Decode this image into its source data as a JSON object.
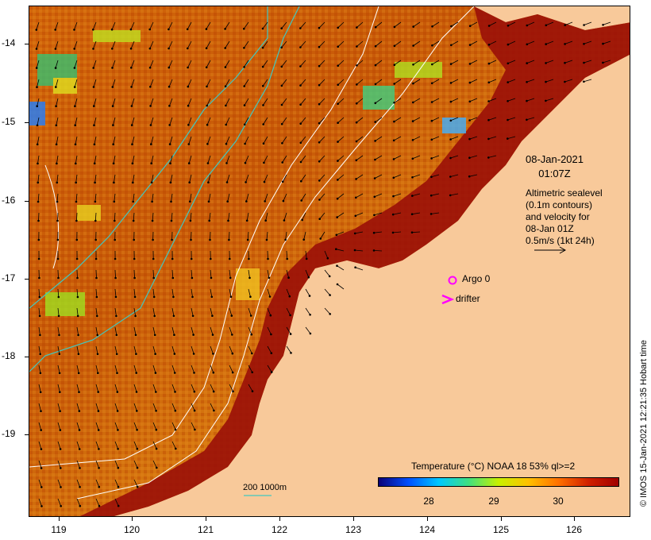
{
  "date_line1": "08-Jan-2021",
  "date_line2": "01:07Z",
  "legend_lines": [
    "Altimetric sealevel",
    "(0.1m contours)",
    "and velocity for",
    "08-Jan 01Z"
  ],
  "velocity_scale_label": "0.5m/s (1kt 24h)",
  "argo_label": "Argo 0",
  "drifter_label": "drifter",
  "depth_contour_label": "200  1000m",
  "colorbar": {
    "title": "Temperature (°C) NOAA 18 53% ql>=2",
    "ticks": [
      "28",
      "29",
      "30"
    ],
    "colors": [
      "#0a0078",
      "#0050ff",
      "#00c8ff",
      "#40e080",
      "#c8f000",
      "#ffc000",
      "#ff7000",
      "#d02000",
      "#a00000"
    ]
  },
  "y_axis": {
    "ticks": [
      "-14",
      "-15",
      "-16",
      "-17",
      "-18",
      "-19"
    ],
    "range": [
      -20.05,
      -13.55
    ]
  },
  "x_axis": {
    "ticks": [
      "119",
      "120",
      "121",
      "122",
      "123",
      "124",
      "125",
      "126"
    ],
    "range": [
      118.6,
      126.7
    ]
  },
  "credit": "© IMOS 15-Jan-2021 12:21:35 Hobart time",
  "colors": {
    "land": "#f8c99a",
    "warm_sst": "#c04000",
    "hot_sst": "#8a0a0a",
    "depth_contour": "#40c8c0",
    "sealevel_contour": "#ffffff",
    "argo_marker": "#ff00ff",
    "drifter_marker": "#ff00ff"
  }
}
